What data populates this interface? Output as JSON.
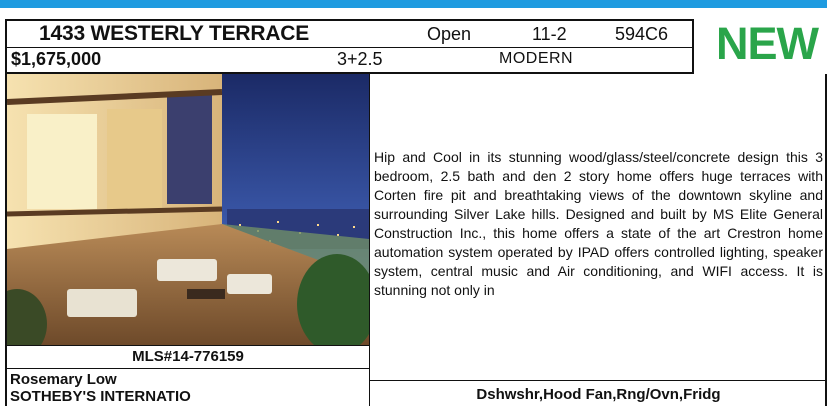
{
  "listing": {
    "address": "1433 WESTERLY TERRACE",
    "open_label": "Open",
    "open_hours": "11-2",
    "map_grid": "594C6",
    "price": "$1,675,000",
    "beds_baths": "3+2.5",
    "style": "MODERN",
    "badge": "NEW",
    "mls": "MLS#14-776159",
    "agent": "Rosemary Low",
    "office": "SOTHEBY'S INTERNATIO",
    "description": "Hip and Cool in its stunning wood/glass/steel/concrete design this 3 bedroom, 2.5 bath and den 2 story home offers huge terraces with Corten fire pit and breathtaking views of the downtown skyline and surrounding Silver Lake hills. Designed and built by MS Elite General Construction Inc., this home offers a state of the art Crestron home automation system operated by IPAD offers controlled lighting, speaker system, central music and Air conditioning, and WIFI access. It is stunning not only in",
    "features": "Dshwshr,Hood Fan,Rng/Ovn,Fridg"
  },
  "colors": {
    "top_bar": "#1f9be0",
    "badge": "#2aa54a",
    "border": "#111111"
  }
}
